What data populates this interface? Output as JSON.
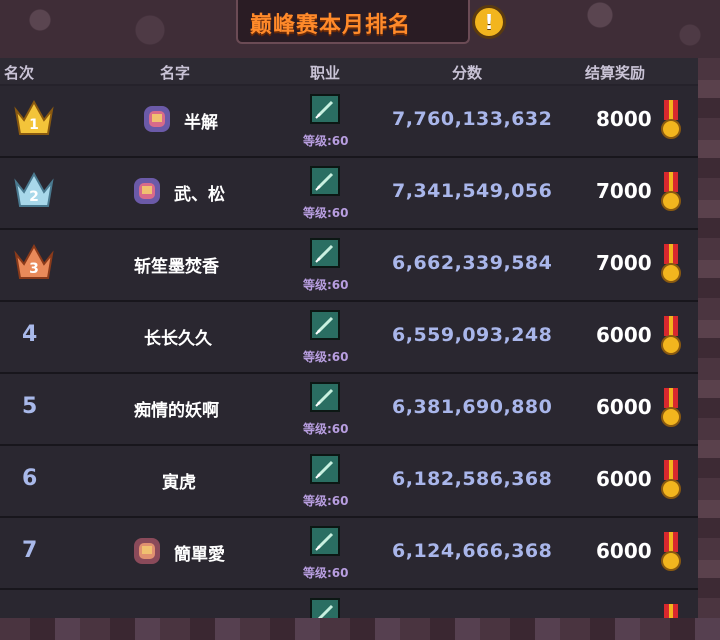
{
  "title": "巅峰赛本月排名",
  "warn_mark": "!",
  "header": {
    "rank": "名次",
    "name": "名字",
    "job": "职业",
    "score": "分数",
    "reward": "结算奖励"
  },
  "level_label": "等级:60",
  "rows": [
    {
      "rank": "1",
      "name": "半解",
      "score": "7,760,133,632",
      "reward": "8000"
    },
    {
      "rank": "2",
      "name": "武、松",
      "score": "7,341,549,056",
      "reward": "7000"
    },
    {
      "rank": "3",
      "name": "斩笙墨焚香",
      "score": "6,662,339,584",
      "reward": "7000"
    },
    {
      "rank": "4",
      "name": "长长久久",
      "score": "6,559,093,248",
      "reward": "6000"
    },
    {
      "rank": "5",
      "name": "痴情的妖啊",
      "score": "6,381,690,880",
      "reward": "6000"
    },
    {
      "rank": "6",
      "name": "寅虎",
      "score": "6,182,586,368",
      "reward": "6000"
    },
    {
      "rank": "7",
      "name": "簡單愛",
      "score": "6,124,666,368",
      "reward": "6000"
    }
  ],
  "colors": {
    "title": "#ff8a2a",
    "score": "#a9b6ea",
    "level": "#b89ee0",
    "gold_crown": "#f3c43a",
    "silver_crown": "#a8d8ea",
    "bronze_crown": "#e98a5a"
  }
}
